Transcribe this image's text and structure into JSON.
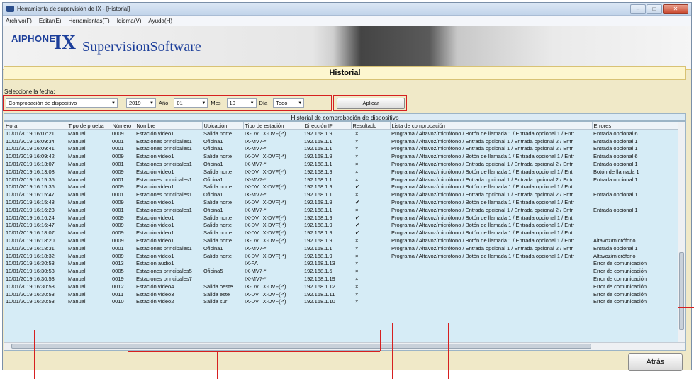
{
  "window": {
    "title": "Herramienta de supervisión de IX - [Historial]"
  },
  "menu": [
    "Archivo(F)",
    "Editar(E)",
    "Herramientas(T)",
    "Idioma(V)",
    "Ayuda(H)"
  ],
  "banner": {
    "brand": "AIPHONE",
    "product_big": "IX",
    "product_rest": "SupervisionSoftware"
  },
  "page_heading": "Historial",
  "date_label": "Seleccione la fecha:",
  "filters": {
    "type": "Comprobación de dispositivo",
    "year": "2019",
    "year_label": "Año",
    "month": "01",
    "month_label": "Mes",
    "day": "10",
    "day_label": "Día",
    "scope": "Todo",
    "apply": "Aplicar"
  },
  "grid_title": "Historial de comprobación de dispositivo",
  "columns": [
    "Hora",
    "Tipo de prueba",
    "Número",
    "Nombre",
    "Ubicación",
    "Tipo de estación",
    "Dirección IP",
    "Resultado",
    "Lista de comprobación",
    "Errores"
  ],
  "rows": [
    [
      "10/01/2019 16:07:21",
      "Manual",
      "0009",
      "Estación vídeo1",
      "Salida norte",
      "IX-DV, IX-DVF(-*)",
      "192.168.1.9",
      "×",
      "Programa / Altavoz/micrófono / Botón de llamada 1 / Entrada opcional 1 / Entr",
      "Entrada opcional 6"
    ],
    [
      "10/01/2019 16:09:34",
      "Manual",
      "0001",
      "Estaciones principales1",
      "Oficina1",
      "IX-MV7-*",
      "192.168.1.1",
      "×",
      "Programa / Altavoz/micrófono / Entrada opcional 1 / Entrada opcional 2 / Entr",
      "Entrada opcional 1"
    ],
    [
      "10/01/2019 16:09:41",
      "Manual",
      "0001",
      "Estaciones principales1",
      "Oficina1",
      "IX-MV7-*",
      "192.168.1.1",
      "×",
      "Programa / Altavoz/micrófono / Entrada opcional 1 / Entrada opcional 2 / Entr",
      "Entrada opcional 1"
    ],
    [
      "10/01/2019 16:09:42",
      "Manual",
      "0009",
      "Estación vídeo1",
      "Salida norte",
      "IX-DV, IX-DVF(-*)",
      "192.168.1.9",
      "×",
      "Programa / Altavoz/micrófono / Botón de llamada 1 / Entrada opcional 1 / Entr",
      "Entrada opcional 6"
    ],
    [
      "10/01/2019 16:13:07",
      "Manual",
      "0001",
      "Estaciones principales1",
      "Oficina1",
      "IX-MV7-*",
      "192.168.1.1",
      "×",
      "Programa / Altavoz/micrófono / Entrada opcional 1 / Entrada opcional 2 / Entr",
      "Entrada opcional 1"
    ],
    [
      "10/01/2019 16:13:08",
      "Manual",
      "0009",
      "Estación vídeo1",
      "Salida norte",
      "IX-DV, IX-DVF(-*)",
      "192.168.1.9",
      "×",
      "Programa / Altavoz/micrófono / Botón de llamada 1 / Entrada opcional 1 / Entr",
      "Botón de llamada 1"
    ],
    [
      "10/01/2019 16:15:35",
      "Manual",
      "0001",
      "Estaciones principales1",
      "Oficina1",
      "IX-MV7-*",
      "192.168.1.1",
      "×",
      "Programa / Altavoz/micrófono / Entrada opcional 1 / Entrada opcional 2 / Entr",
      "Entrada opcional 1"
    ],
    [
      "10/01/2019 16:15:36",
      "Manual",
      "0009",
      "Estación vídeo1",
      "Salida norte",
      "IX-DV, IX-DVF(-*)",
      "192.168.1.9",
      "✔",
      "Programa / Altavoz/micrófono / Botón de llamada 1 / Entrada opcional 1 / Entr",
      ""
    ],
    [
      "10/01/2019 16:15:47",
      "Manual",
      "0001",
      "Estaciones principales1",
      "Oficina1",
      "IX-MV7-*",
      "192.168.1.1",
      "×",
      "Programa / Altavoz/micrófono / Entrada opcional 1 / Entrada opcional 2 / Entr",
      "Entrada opcional 1"
    ],
    [
      "10/01/2019 16:15:48",
      "Manual",
      "0009",
      "Estación vídeo1",
      "Salida norte",
      "IX-DV, IX-DVF(-*)",
      "192.168.1.9",
      "✔",
      "Programa / Altavoz/micrófono / Botón de llamada 1 / Entrada opcional 1 / Entr",
      ""
    ],
    [
      "10/01/2019 16:16:23",
      "Manual",
      "0001",
      "Estaciones principales1",
      "Oficina1",
      "IX-MV7-*",
      "192.168.1.1",
      "×",
      "Programa / Altavoz/micrófono / Entrada opcional 1 / Entrada opcional 2 / Entr",
      "Entrada opcional 1"
    ],
    [
      "10/01/2019 16:16:24",
      "Manual",
      "0009",
      "Estación vídeo1",
      "Salida norte",
      "IX-DV, IX-DVF(-*)",
      "192.168.1.9",
      "✔",
      "Programa / Altavoz/micrófono / Botón de llamada 1 / Entrada opcional 1 / Entr",
      ""
    ],
    [
      "10/01/2019 16:16:47",
      "Manual",
      "0009",
      "Estación vídeo1",
      "Salida norte",
      "IX-DV, IX-DVF(-*)",
      "192.168.1.9",
      "✔",
      "Programa / Altavoz/micrófono / Botón de llamada 1 / Entrada opcional 1 / Entr",
      ""
    ],
    [
      "10/01/2019 16:18:07",
      "Manual",
      "0009",
      "Estación vídeo1",
      "Salida norte",
      "IX-DV, IX-DVF(-*)",
      "192.168.1.9",
      "✔",
      "Programa / Altavoz/micrófono / Botón de llamada 1 / Entrada opcional 1 / Entr",
      ""
    ],
    [
      "10/01/2019 16:18:20",
      "Manual",
      "0009",
      "Estación vídeo1",
      "Salida norte",
      "IX-DV, IX-DVF(-*)",
      "192.168.1.9",
      "×",
      "Programa / Altavoz/micrófono / Botón de llamada 1 / Entrada opcional 1 / Entr",
      "Altavoz/micrófono"
    ],
    [
      "10/01/2019 16:18:31",
      "Manual",
      "0001",
      "Estaciones principales1",
      "Oficina1",
      "IX-MV7-*",
      "192.168.1.1",
      "×",
      "Programa / Altavoz/micrófono / Entrada opcional 1 / Entrada opcional 2 / Entr",
      "Entrada opcional 1"
    ],
    [
      "10/01/2019 16:18:32",
      "Manual",
      "0009",
      "Estación vídeo1",
      "Salida norte",
      "IX-DV, IX-DVF(-*)",
      "192.168.1.9",
      "×",
      "Programa / Altavoz/micrófono / Botón de llamada 1 / Entrada opcional 1 / Entr",
      "Altavoz/micrófono"
    ],
    [
      "10/01/2019 16:30:53",
      "Manual",
      "0013",
      "Estación audio1",
      "",
      "IX-FA",
      "192.168.1.13",
      "×",
      "",
      "Error de comunicación"
    ],
    [
      "10/01/2019 16:30:53",
      "Manual",
      "0005",
      "Estaciones principales5",
      "Oficina5",
      "IX-MV7-*",
      "192.168.1.5",
      "×",
      "",
      "Error de comunicación"
    ],
    [
      "10/01/2019 16:30:53",
      "Manual",
      "0019",
      "Estaciones principales7",
      "",
      "IX-MV7-*",
      "192.168.1.19",
      "×",
      "",
      "Error de comunicación"
    ],
    [
      "10/01/2019 16:30:53",
      "Manual",
      "0012",
      "Estación vídeo4",
      "Salida oeste",
      "IX-DV, IX-DVF(-*)",
      "192.168.1.12",
      "×",
      "",
      "Error de comunicación"
    ],
    [
      "10/01/2019 16:30:53",
      "Manual",
      "0011",
      "Estación vídeo3",
      "Salida este",
      "IX-DV, IX-DVF(-*)",
      "192.168.1.11",
      "×",
      "",
      "Error de comunicación"
    ],
    [
      "10/01/2019 16:30:53",
      "Manual",
      "0010",
      "Estación vídeo2",
      "Salida sur",
      "IX-DV, IX-DVF(-*)",
      "192.168.1.10",
      "×",
      "",
      "Error de comunicación"
    ]
  ],
  "back_button": "Atrás",
  "colors": {
    "accent_blue": "#1d3f9a",
    "callout_red": "#d62020",
    "grid_bg": "#d6ecf6",
    "panel_bg": "#f0e9c8"
  }
}
